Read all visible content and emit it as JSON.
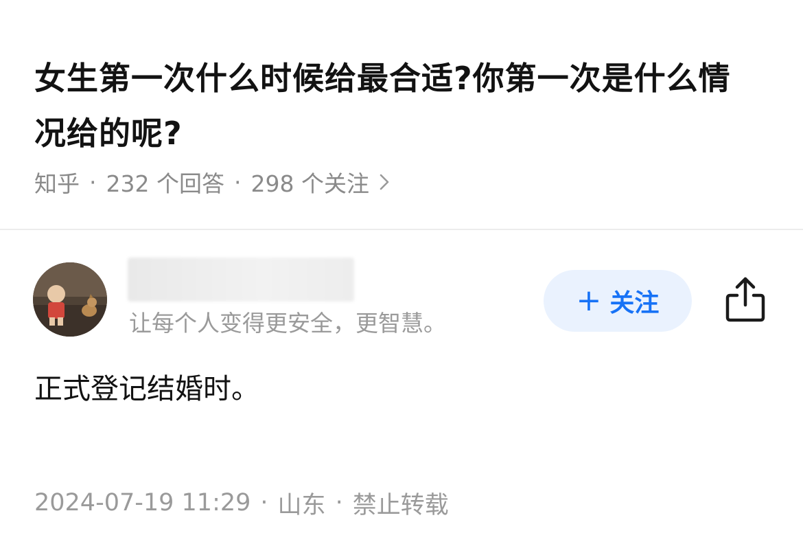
{
  "question": {
    "title": "女生第一次什么时候给最合适?你第一次是什么情况给的呢?",
    "source": "知乎",
    "answers_count": "232 个回答",
    "followers_count": "298 个关注"
  },
  "author": {
    "bio": "让每个人变得更安全，更智慧。",
    "follow_label": "关注",
    "follow_icon": "plus-icon",
    "share_icon": "share-icon"
  },
  "answer": {
    "text": "正式登记结婚时。",
    "date": "2024-07-19 11:29",
    "location": "山东",
    "copyright": "禁止转载"
  },
  "colors": {
    "accent": "#1772f6",
    "follow_bg": "#eaf2fe",
    "muted_text": "#8a8a8a"
  }
}
